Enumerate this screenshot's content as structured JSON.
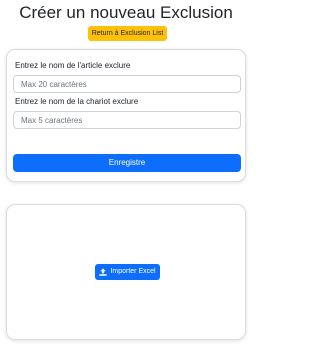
{
  "header": {
    "title": "Créer un nouveau Exclusion",
    "return_label": "Return à Exclusion List"
  },
  "form": {
    "article_label": "Entrez le nom de l'article exclure",
    "article_placeholder": "Max 20 caractères",
    "chariot_label": "Entrez le nom de la chariot exclure",
    "chariot_placeholder": "Max 5 caractères",
    "submit_label": "Enregistre"
  },
  "import": {
    "button_label": "Importer Excel",
    "icon": "upload-icon"
  },
  "colors": {
    "primary": "#0d6efd",
    "warning": "#ffc107"
  }
}
